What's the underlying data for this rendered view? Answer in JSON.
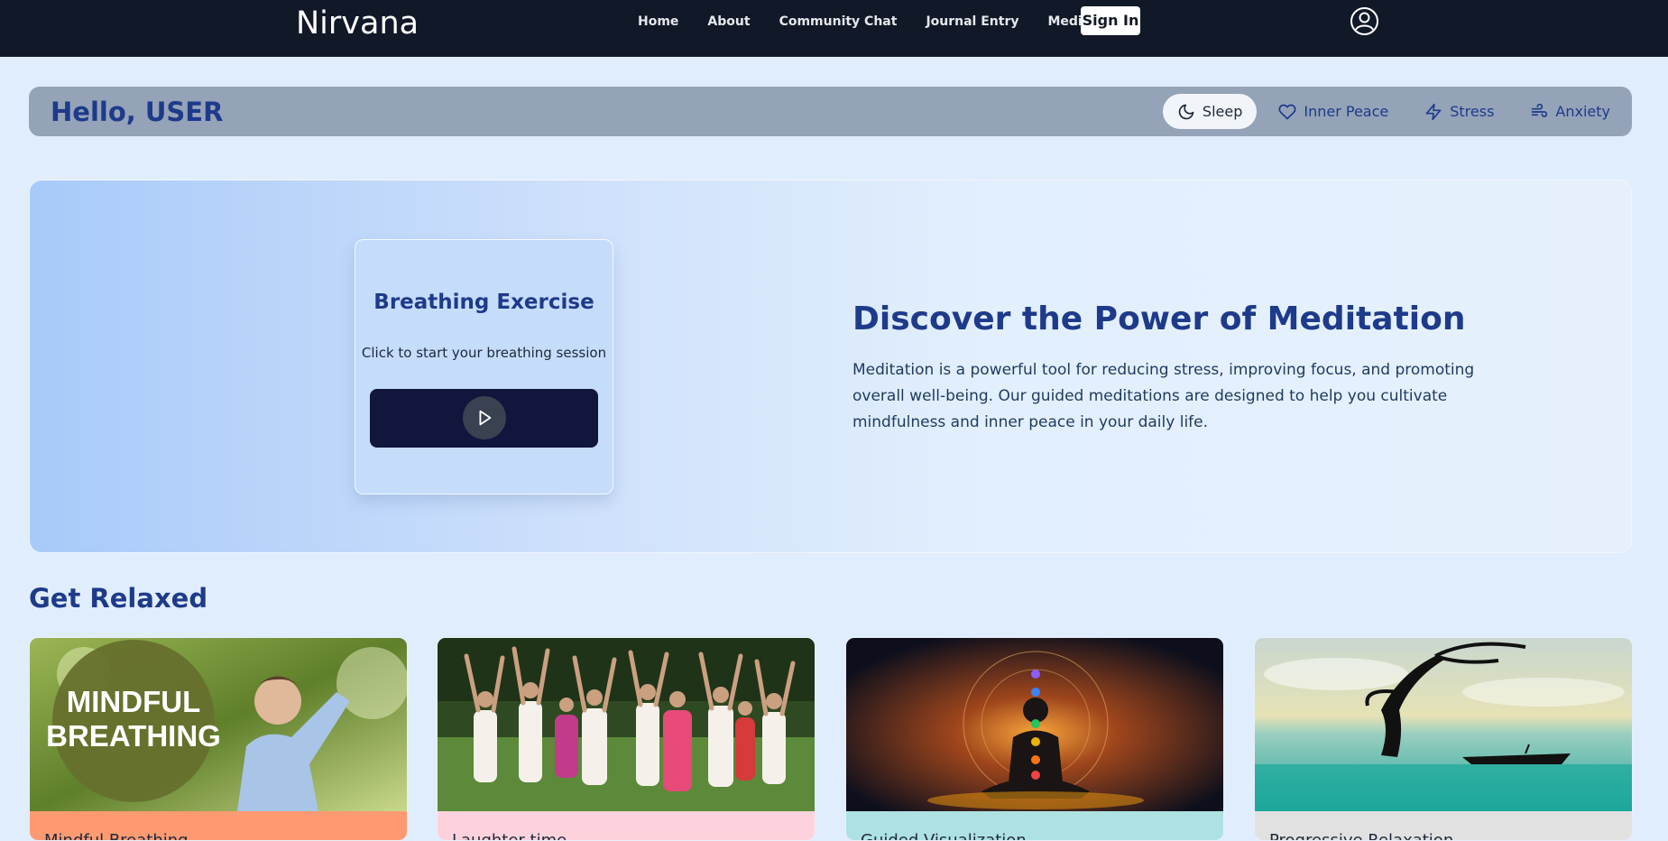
{
  "nav": {
    "brand": "Nirvana",
    "links": [
      "Home",
      "About",
      "Community Chat",
      "Journal Entry",
      "Meditation"
    ],
    "sign_in": "Sign In"
  },
  "greeting": {
    "text": "Hello, USER",
    "tabs": [
      {
        "label": "Sleep",
        "icon": "moon-icon",
        "active": true
      },
      {
        "label": "Inner Peace",
        "icon": "heart-icon",
        "active": false
      },
      {
        "label": "Stress",
        "icon": "lightning-icon",
        "active": false
      },
      {
        "label": "Anxiety",
        "icon": "wind-icon",
        "active": false
      }
    ]
  },
  "breathing": {
    "title": "Breathing Exercise",
    "subtitle": "Click to start your breathing session"
  },
  "hero": {
    "title": "Discover the Power of Meditation",
    "text": "Meditation is a powerful tool for reducing stress, improving focus, and promoting overall well-being. Our guided meditations are designed to help you cultivate mindfulness and inner peace in your daily life."
  },
  "section": {
    "title": "Get Relaxed"
  },
  "cards": [
    {
      "title": "Mindful Breathing",
      "image_text": "MINDFUL BREATHING",
      "color": "#fd9a72"
    },
    {
      "title": "Laughter time",
      "color": "#fed2dc"
    },
    {
      "title": "Guided Visualization",
      "color": "#aee2e2"
    },
    {
      "title": "Progressive Relaxation",
      "color": "#e1e1e1"
    }
  ],
  "colors": {
    "navbar": "#111827",
    "page_bg": "#e0edfc",
    "greeting_bar": "#94a3b8",
    "accent_text": "#1e3a8a"
  }
}
